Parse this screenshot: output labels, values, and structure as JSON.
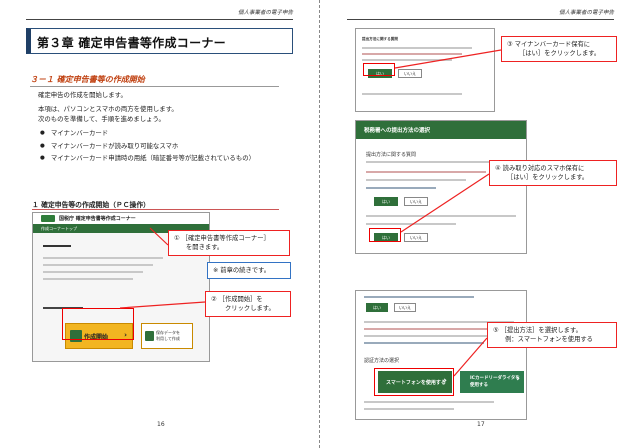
{
  "left_page": {
    "header": "個人事業者の電子申告",
    "chapter_title": "第３章 確定申告書等作成コーナー",
    "section_title": "３－１ 確定申告書等の作成開始",
    "intro_lines": [
      "確定申告の作成を開始します。",
      "本項は、パソコンとスマホの両方を使用します。",
      "次のものを準備して、手順を進めましょう。"
    ],
    "bullets": [
      "マイナンバーカード",
      "マイナンバーカードが読み取り可能なスマホ",
      "マイナンバーカード申請時の用紙（暗証番号等が記載されているもの）"
    ],
    "subheading": "１ 確定申告等の作成開始（ＰＣ操作）",
    "screenshot": {
      "site_title": "国税庁 確定申告書等作成コーナー",
      "nav_bar": "作成コーナートップ",
      "start_button": "作成開始",
      "save_button_line1": "保存データを",
      "save_button_line2": "利用して作成"
    },
    "callouts": {
      "c1_line1": "① ［確定申告書等作成コーナー］",
      "c1_line2": "を開きます。",
      "note": "※ 前章の続きです。",
      "c2_line1": "② ［作成開始］を",
      "c2_line2": "クリックします。"
    },
    "page_number": "16"
  },
  "right_page": {
    "header": "個人事業者の電子申告",
    "panel1": {
      "title": "提出方法に関する質問",
      "yes": "はい",
      "no": "いいえ"
    },
    "panel2": {
      "header": "税務署への提出方法の選択",
      "question": "提出方法に関する質問",
      "yes": "はい",
      "no": "いいえ"
    },
    "panel3": {
      "yes": "はい",
      "no": "いいえ",
      "section": "認証方法の選択",
      "smartphone_button": "スマートフォンを使用する",
      "icreader_button_line1": "ICカードリーダライタを",
      "icreader_button_line2": "使用する"
    },
    "callouts": {
      "c3_line1": "③ マイナンバーカード保有に",
      "c3_line2": "［はい］をクリックします。",
      "c4_line1": "④ 読み取り対応のスマホ保有に",
      "c4_line2": "［はい］をクリックします。",
      "c5_line1": "⑤ ［提出方法］を選択します。",
      "c5_line2": "例：スマートフォンを使用する"
    },
    "page_number": "17"
  },
  "colors": {
    "accent_red": "#e22222",
    "site_green": "#2f6f3a",
    "button_yellow": "#f2b521",
    "note_blue": "#3373c4"
  }
}
